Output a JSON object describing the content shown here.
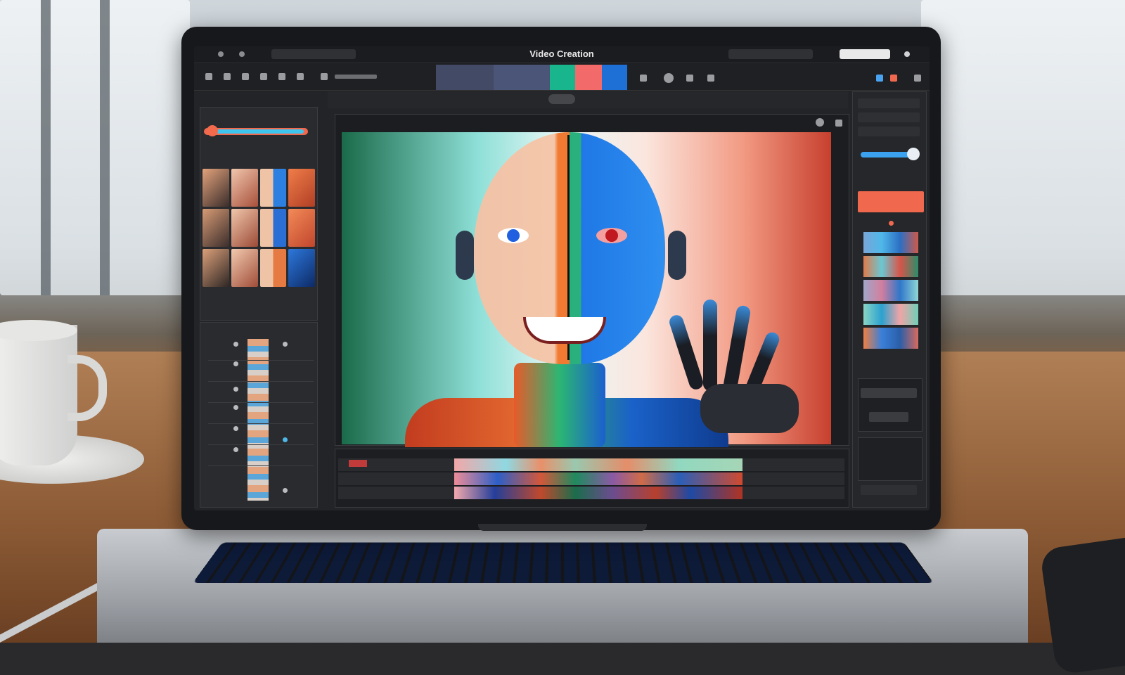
{
  "app": {
    "window_title": "Video Creation"
  },
  "icons": {
    "titlebar": [
      "window-dot-icon",
      "window-dot-icon"
    ],
    "viewer_close": "close-icon",
    "viewer_settings": "gear-icon"
  },
  "colors": {
    "accent_orange": "#f0694f",
    "accent_blue": "#3aa2ee",
    "accent_green": "#2ab07d"
  }
}
